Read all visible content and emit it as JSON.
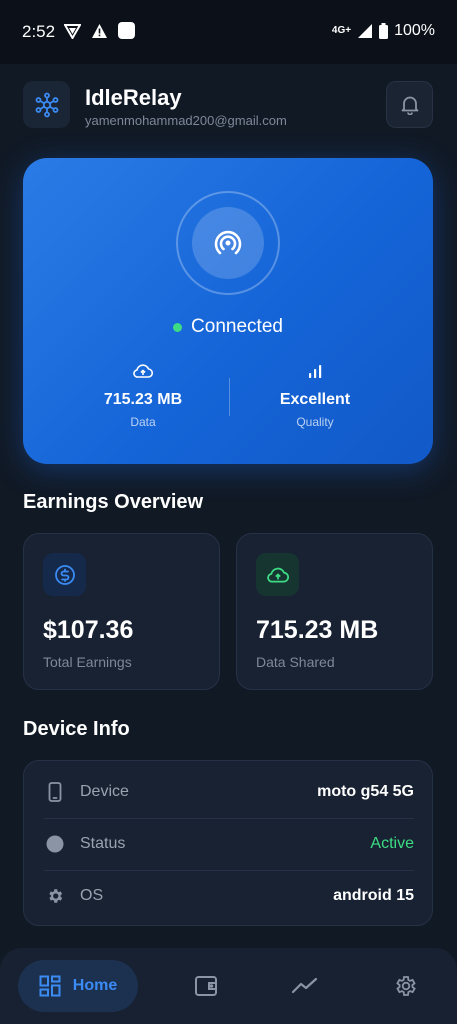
{
  "status_bar": {
    "time": "2:52",
    "network": "4G+",
    "battery": "100%"
  },
  "header": {
    "title": "IdleRelay",
    "email": "yamenmohammad200@gmail.com"
  },
  "hero": {
    "status": "Connected",
    "data_value": "715.23 MB",
    "data_label": "Data",
    "quality_value": "Excellent",
    "quality_label": "Quality"
  },
  "earnings": {
    "title": "Earnings Overview",
    "total_value": "$107.36",
    "total_label": "Total Earnings",
    "shared_value": "715.23 MB",
    "shared_label": "Data Shared"
  },
  "device_info": {
    "title": "Device Info",
    "rows": [
      {
        "key": "Device",
        "value": "moto g54 5G"
      },
      {
        "key": "Status",
        "value": "Active"
      },
      {
        "key": "OS",
        "value": "android 15"
      }
    ]
  },
  "nav": {
    "home_label": "Home"
  },
  "colors": {
    "background": "#111925",
    "accent": "#1e6fe0",
    "success": "#3ddc84",
    "nav_active": "#3b8bf5"
  },
  "icons": [
    "hub-icon",
    "bell-icon",
    "broadcast-icon",
    "cloud-upload-icon",
    "signal-bars-icon",
    "dollar-icon",
    "phone-icon",
    "gear-icon",
    "home-grid-icon",
    "wallet-icon",
    "trending-icon",
    "settings-icon"
  ]
}
